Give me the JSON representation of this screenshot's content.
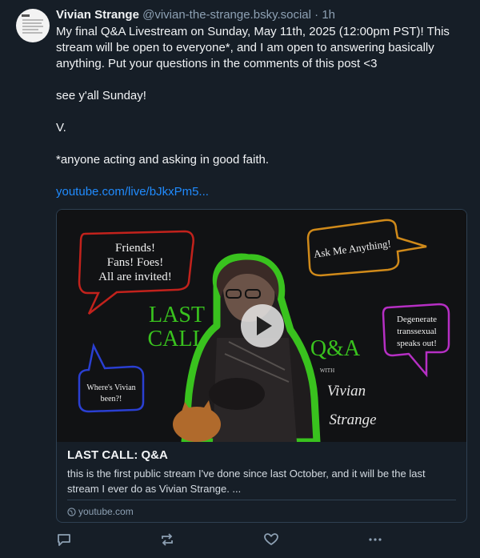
{
  "post": {
    "display_name": "Vivian Strange",
    "handle": "@vivian-the-strange.bsky.social",
    "separator": "·",
    "time": "1h",
    "text_line1": "My final Q&A Livestream on Sunday, May 11th, 2025 (12:00pm PST)! This stream will be open to everyone*, and I am open to answering basically anything. Put your questions in the comments of this post <3",
    "text_line2": "see y'all Sunday!",
    "text_line3": "V.",
    "text_line4": "*anyone acting and asking in good faith.",
    "link_text": "youtube.com/live/bJkxPm5..."
  },
  "card": {
    "thumbnail": {
      "bubble_red": "Friends! Fans! Foes! All are invited!",
      "bubble_red_l1": "Friends!",
      "bubble_red_l2": "Fans! Foes!",
      "bubble_red_l3": "All are invited!",
      "bubble_orange": "Ask Me Anything!",
      "bubble_purple_l1": "Degenerate",
      "bubble_purple_l2": "transsexual",
      "bubble_purple_l3": "speaks out!",
      "bubble_blue_l1": "Where's Vivian",
      "bubble_blue_l2": "been?!",
      "last": "LAST",
      "call": "CALL",
      "qa": "Q&A",
      "with": "WITH",
      "sig_l1": "Vivian",
      "sig_l2": "Strange"
    },
    "title": "LAST CALL: Q&A",
    "description": "this is the first public stream I've done since last October, and it will be the last stream I ever do as Vivian Strange. ...",
    "domain": "youtube.com"
  },
  "colors": {
    "background": "#161e27",
    "link": "#208bfe",
    "muted": "#8da0b3",
    "border": "#2e4052",
    "neon_green": "#39c21e",
    "bubble_red": "#c2221c",
    "bubble_orange": "#d08a1a",
    "bubble_purple": "#b62fc4",
    "bubble_blue": "#2a3fd2"
  },
  "icons": {
    "reply": "speech-bubble",
    "repost": "repost-arrows",
    "like": "heart",
    "more": "ellipsis",
    "play": "play-triangle",
    "globe": "globe"
  }
}
